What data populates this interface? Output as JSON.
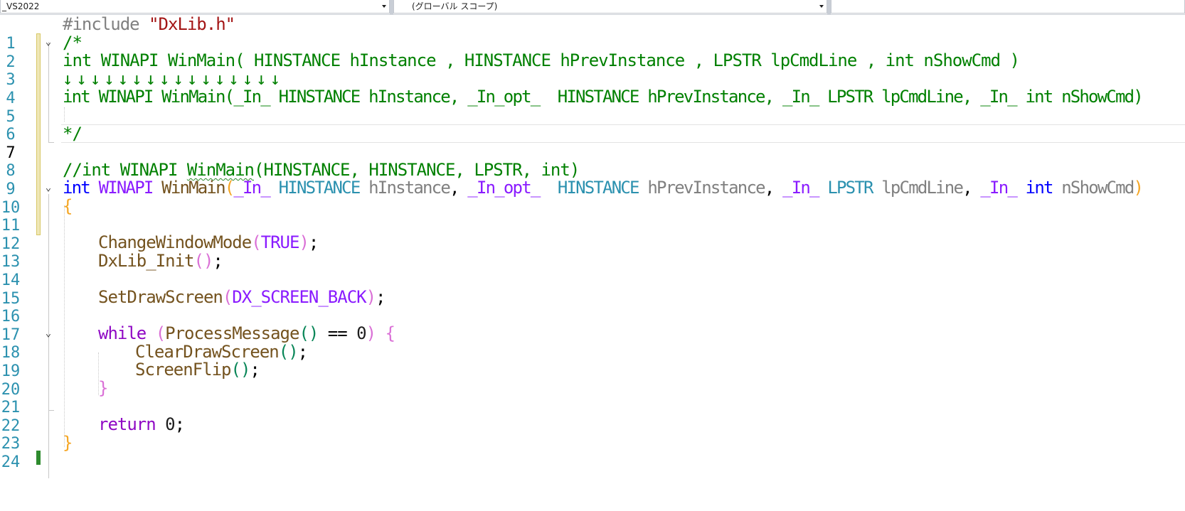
{
  "navbar": {
    "project": "_VS2022",
    "scope": "(グローバル スコープ)",
    "member": ""
  },
  "editor": {
    "current_line": "7",
    "lines": [
      {
        "n": "1"
      },
      {
        "n": "2"
      },
      {
        "n": "3"
      },
      {
        "n": "4"
      },
      {
        "n": "5"
      },
      {
        "n": "6"
      },
      {
        "n": "7"
      },
      {
        "n": "8"
      },
      {
        "n": "9"
      },
      {
        "n": "10"
      },
      {
        "n": "11"
      },
      {
        "n": "12"
      },
      {
        "n": "13"
      },
      {
        "n": "14"
      },
      {
        "n": "15"
      },
      {
        "n": "16"
      },
      {
        "n": "17"
      },
      {
        "n": "18"
      },
      {
        "n": "19"
      },
      {
        "n": "20"
      },
      {
        "n": "21"
      },
      {
        "n": "22"
      },
      {
        "n": "23"
      },
      {
        "n": "24"
      }
    ],
    "tokens": {
      "l1_dir": "#include ",
      "l1_str": "\"DxLib.h\"",
      "l2": "/*",
      "l3": "int WINAPI WinMain( HINSTANCE hInstance , HINSTANCE hPrevInstance , LPSTR lpCmdLine , int nShowCmd )",
      "l4": "↓↓↓↓↓↓↓↓↓↓↓↓↓↓↓↓",
      "l5": "int WINAPI WinMain(_In_ HINSTANCE hInstance, _In_opt_  HINSTANCE hPrevInstance, _In_ LPSTR lpCmdLine, _In_ int nShowCmd)",
      "l7": "*/",
      "l9_a": "//int WINAPI ",
      "l9_b": "WinMain",
      "l9_c": "(HINSTANCE, HINSTANCE, LPSTR, int)",
      "l10_int1": "int",
      "l10_winapi": "WINAPI",
      "l10_winmain": "WinMain",
      "l10_p_open": "(",
      "l10_in1": "_In_",
      "l10_hinst1": "HINSTANCE",
      "l10_hinstance": "hInstance",
      "l10_comma": ",",
      "l10_inopt": "_In_opt_",
      "l10_hinst2": "HINSTANCE",
      "l10_hprev": "hPrevInstance",
      "l10_in2": "_In_",
      "l10_lpstr": "LPSTR",
      "l10_lpcmd": "lpCmdLine",
      "l10_in3": "_In_",
      "l10_int2": "int",
      "l10_nshow": "nShowCmd",
      "l10_p_close": ")",
      "l11": "{",
      "l13_fn": "ChangeWindowMode",
      "l13_o": "(",
      "l13_arg": "TRUE",
      "l13_c": ")",
      "l13_semi": ";",
      "l14_fn": "DxLib_Init",
      "l14_o": "(",
      "l14_c": ")",
      "l14_semi": ";",
      "l16_fn": "SetDrawScreen",
      "l16_o": "(",
      "l16_arg": "DX_SCREEN_BACK",
      "l16_c": ")",
      "l16_semi": ";",
      "l18_kw": "while",
      "l18_o": "(",
      "l18_fn": "ProcessMessage",
      "l18_po": "(",
      "l18_pc": ")",
      "l18_op": " == ",
      "l18_zero": "0",
      "l18_c": ")",
      "l18_brace": "{",
      "l19_fn": "ClearDrawScreen",
      "l19_o": "(",
      "l19_c": ")",
      "l19_semi": ";",
      "l20_fn": "ScreenFlip",
      "l20_o": "(",
      "l20_c": ")",
      "l20_semi": ";",
      "l21": "}",
      "l23_kw": "return",
      "l23_zero": "0",
      "l23_semi": ";",
      "l24": "}"
    }
  },
  "colors": {
    "comment": "#008000",
    "keyword": "#0000ff",
    "type": "#2b91af",
    "function": "#74531f",
    "macro": "#8a1bff",
    "line_number": "#2b91af"
  }
}
